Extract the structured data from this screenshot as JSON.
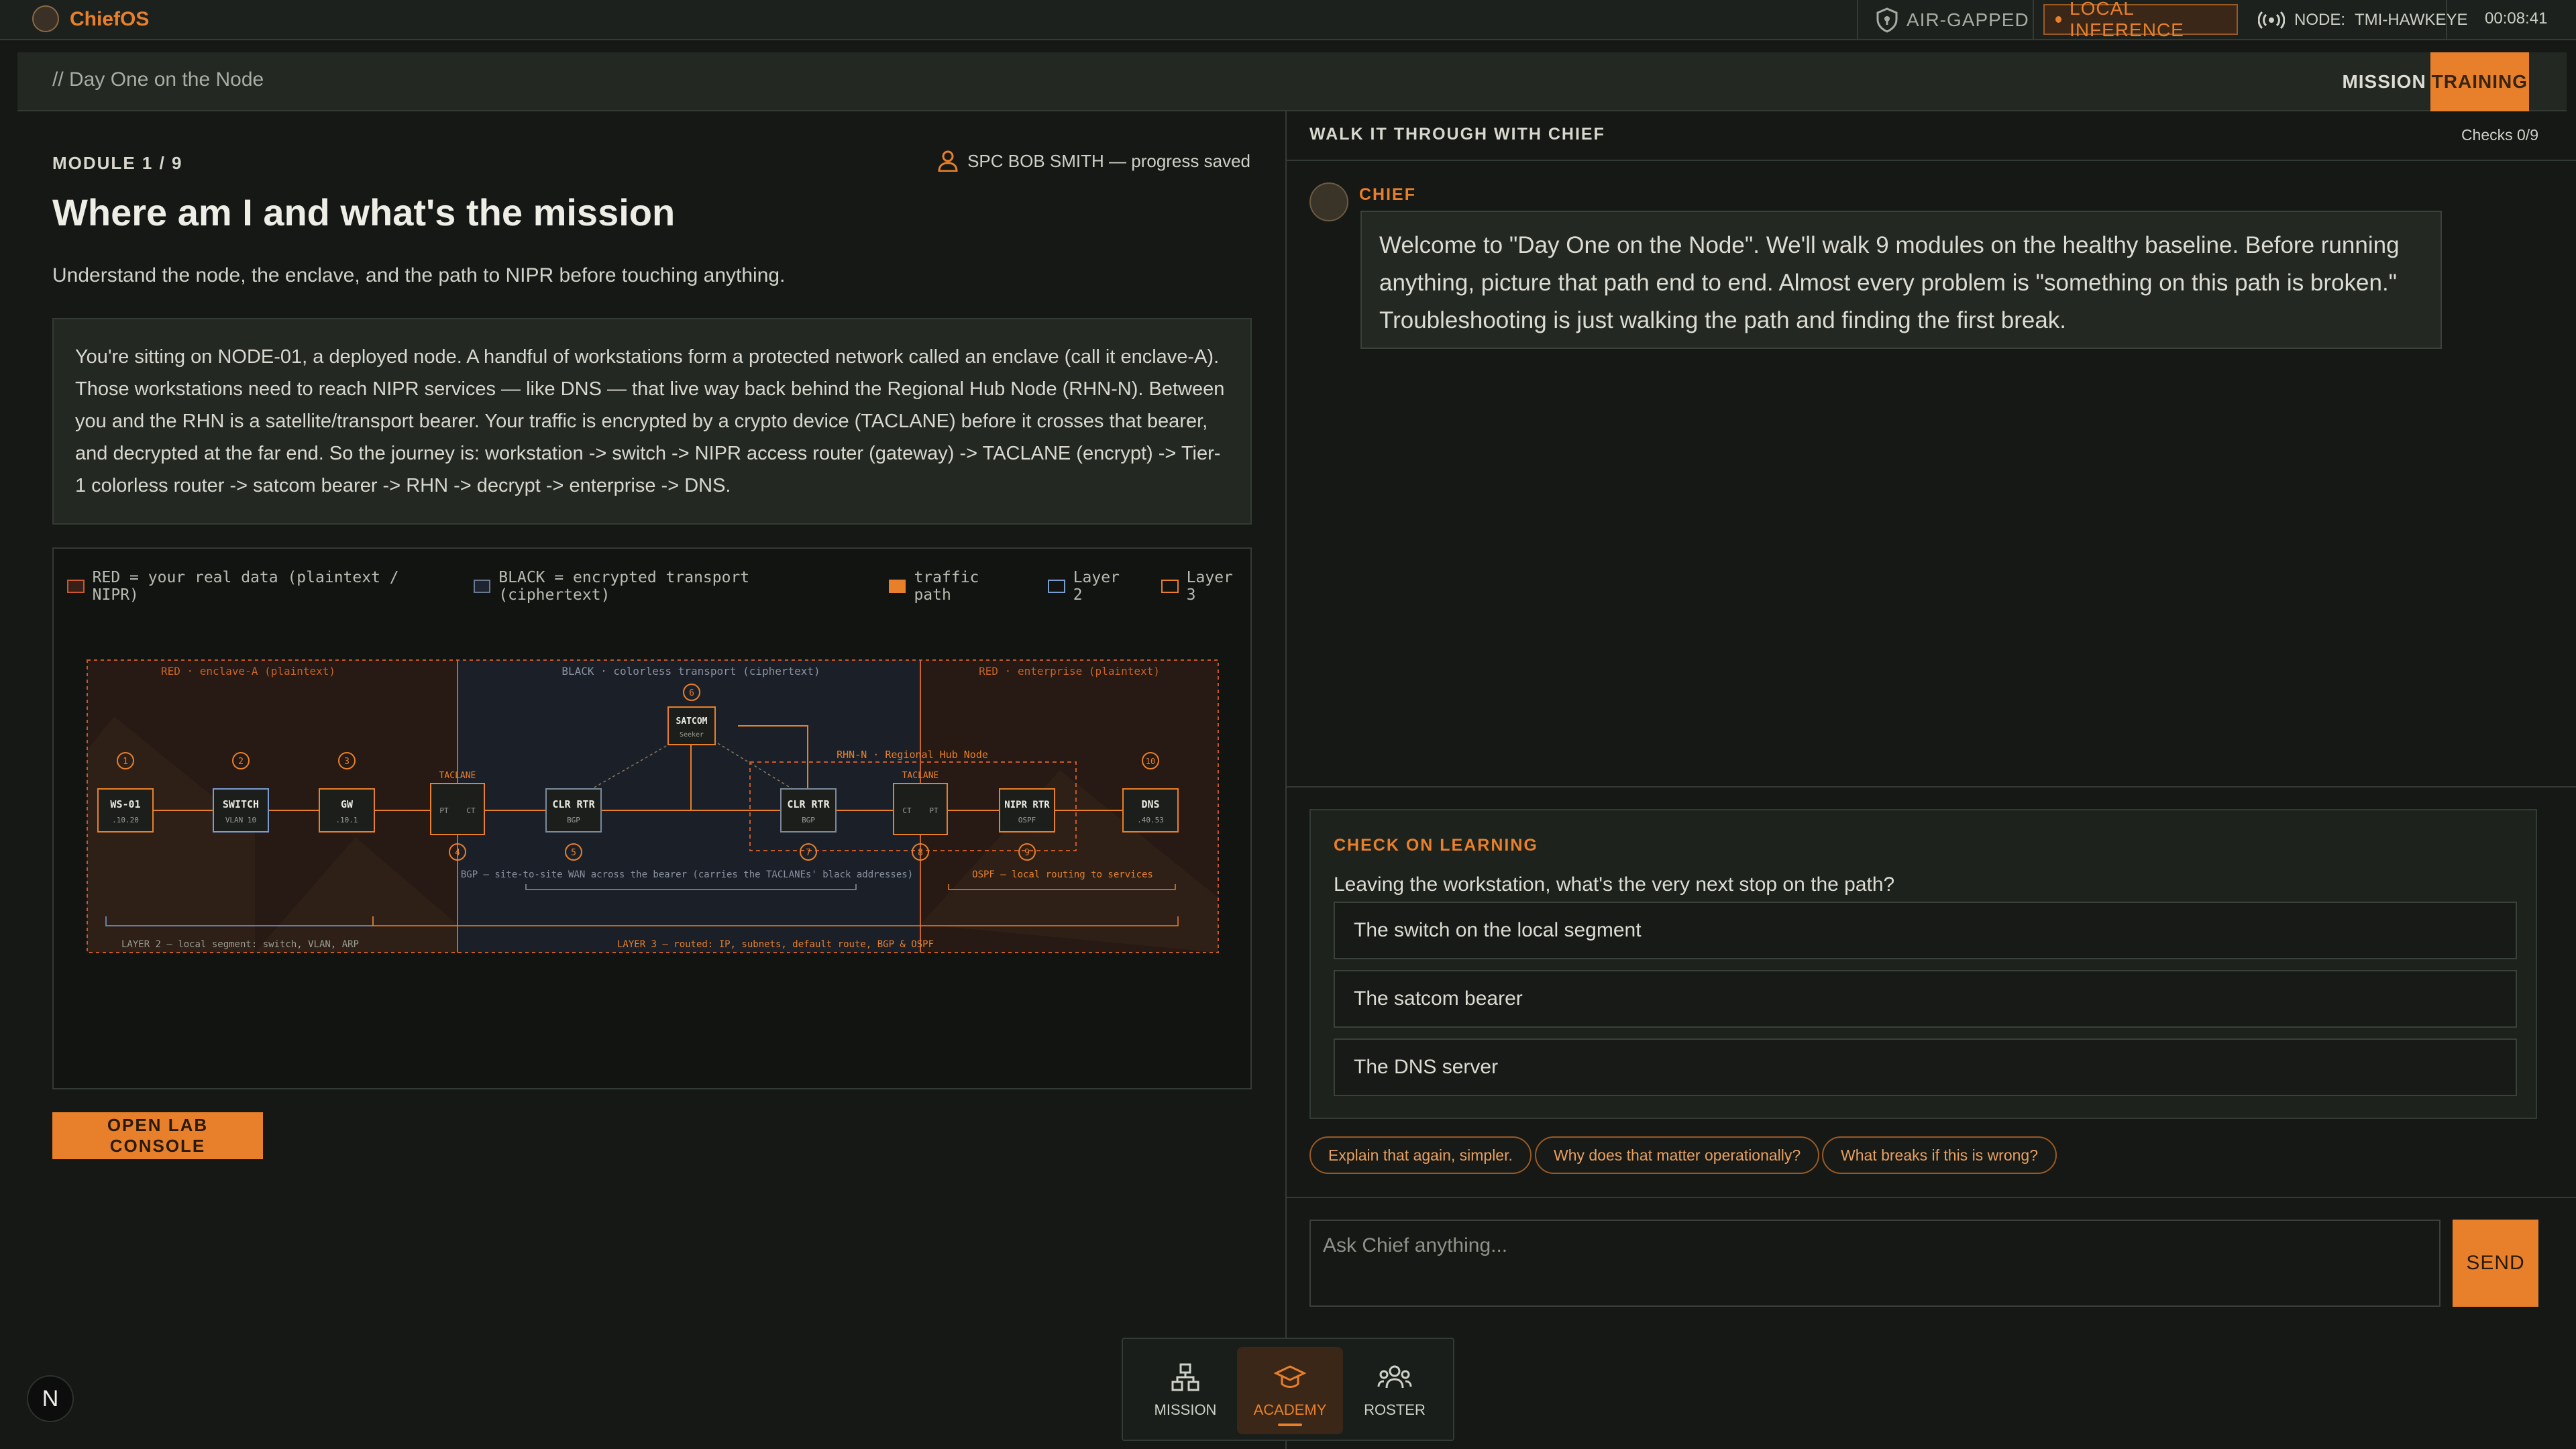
{
  "topbar": {
    "brand": "ChiefOS",
    "status": {
      "airgap": "AIR-GAPPED",
      "inference": "LOCAL INFERENCE",
      "node_label": "NODE:",
      "node_name": "TMI-HAWKEYE",
      "clock": "00:08:41"
    }
  },
  "crumb": "// Day One on the Node",
  "tabs": [
    {
      "label": "MISSION",
      "active": false
    },
    {
      "label": "TRAINING",
      "active": true
    }
  ],
  "module": {
    "num": "MODULE 1 / 9",
    "user": "SPC BOB SMITH — progress saved",
    "title": "Where am I and what's the mission",
    "subtitle": "Understand the node, the enclave, and the path to NIPR before touching anything.",
    "intro": "You're sitting on NODE-01, a deployed node. A handful of workstations form a protected network called an enclave (call it enclave-A). Those workstations need to reach NIPR services — like DNS — that live way back behind the Regional Hub Node (RHN-N). Between you and the RHN is a satellite/transport bearer. Your traffic is encrypted by a crypto device (TACLANE) before it crosses that bearer, and decrypted at the far end. So the journey is: workstation -> switch -> NIPR access router (gateway) -> TACLANE (encrypt) -> Tier-1 colorless router -> satcom bearer -> RHN -> decrypt -> enterprise -> DNS.",
    "lab_button": "OPEN LAB CONSOLE"
  },
  "diagram": {
    "legend": [
      {
        "label": "RED = your real data (plaintext / NIPR)",
        "color": "#c85a2a",
        "fill": "#3a1f16"
      },
      {
        "label": "BLACK = encrypted transport (ciphertext)",
        "color": "#6a7890",
        "fill": "#1e2430"
      },
      {
        "label": "traffic path",
        "color": "#e8802b",
        "fill": "#e8802b"
      },
      {
        "label": "Layer 2",
        "color": "#7a9cd0",
        "fill": "none"
      },
      {
        "label": "Layer 3",
        "color": "#e8802b",
        "fill": "none"
      }
    ],
    "zones": {
      "red_a": "RED · enclave-A (plaintext)",
      "black": "BLACK · colorless transport (ciphertext)",
      "red_e": "RED · enterprise (plaintext)",
      "rhn": "RHN-N · Regional Hub Node"
    },
    "nodes": [
      {
        "num": "1",
        "name": "WS-01",
        "sub": ".10.20"
      },
      {
        "num": "2",
        "name": "SWITCH",
        "sub": "VLAN 10"
      },
      {
        "num": "3",
        "name": "GW",
        "sub": ".10.1"
      },
      {
        "num": "4",
        "name": "TACLANE",
        "pt": "PT",
        "ct": "CT"
      },
      {
        "num": "5",
        "name": "CLR RTR",
        "sub": "BGP"
      },
      {
        "num": "6",
        "name": "SATCOM",
        "sub": "Seeker"
      },
      {
        "num": "7",
        "name": "CLR RTR",
        "sub": "BGP"
      },
      {
        "num": "8",
        "name": "TACLANE",
        "pt": "PT",
        "ct": "CT"
      },
      {
        "num": "9",
        "name": "NIPR RTR",
        "sub": "OSPF"
      },
      {
        "num": "10",
        "name": "DNS",
        "sub": ".40.53"
      }
    ],
    "annotations": {
      "bgp": "BGP — site-to-site WAN across the bearer (carries the TACLANEs' black addresses)",
      "ospf": "OSPF — local routing to services",
      "layer2": "LAYER 2 — local segment: switch, VLAN, ARP",
      "layer3": "LAYER 3 — routed: IP, subnets, default route, BGP & OSPF"
    }
  },
  "chat": {
    "header": "WALK IT THROUGH WITH CHIEF",
    "checks": "Checks 0/9",
    "chief_name": "CHIEF",
    "message": "Welcome to \"Day One on the Node\". We'll walk 9 modules on the healthy baseline. Before running anything, picture that path end to end. Almost every problem is \"something on this path is broken.\" Troubleshooting is just walking the path and finding the first break."
  },
  "quiz": {
    "header": "CHECK ON LEARNING",
    "question": "Leaving the workstation, what's the very next stop on the path?",
    "options": [
      "The switch on the local segment",
      "The satcom bearer",
      "The DNS server"
    ]
  },
  "chips": [
    "Explain that again, simpler.",
    "Why does that matter operationally?",
    "What breaks if this is wrong?"
  ],
  "ask": {
    "placeholder": "Ask Chief anything...",
    "send": "SEND"
  },
  "dock": [
    {
      "label": "MISSION",
      "icon": "network-icon"
    },
    {
      "label": "ACADEMY",
      "icon": "graduation-cap-icon",
      "active": true
    },
    {
      "label": "ROSTER",
      "icon": "people-icon"
    }
  ],
  "badge": "N",
  "colors": {
    "accent": "#e8802b",
    "bg": "#151815",
    "panel": "#232823",
    "border": "#343a34"
  }
}
